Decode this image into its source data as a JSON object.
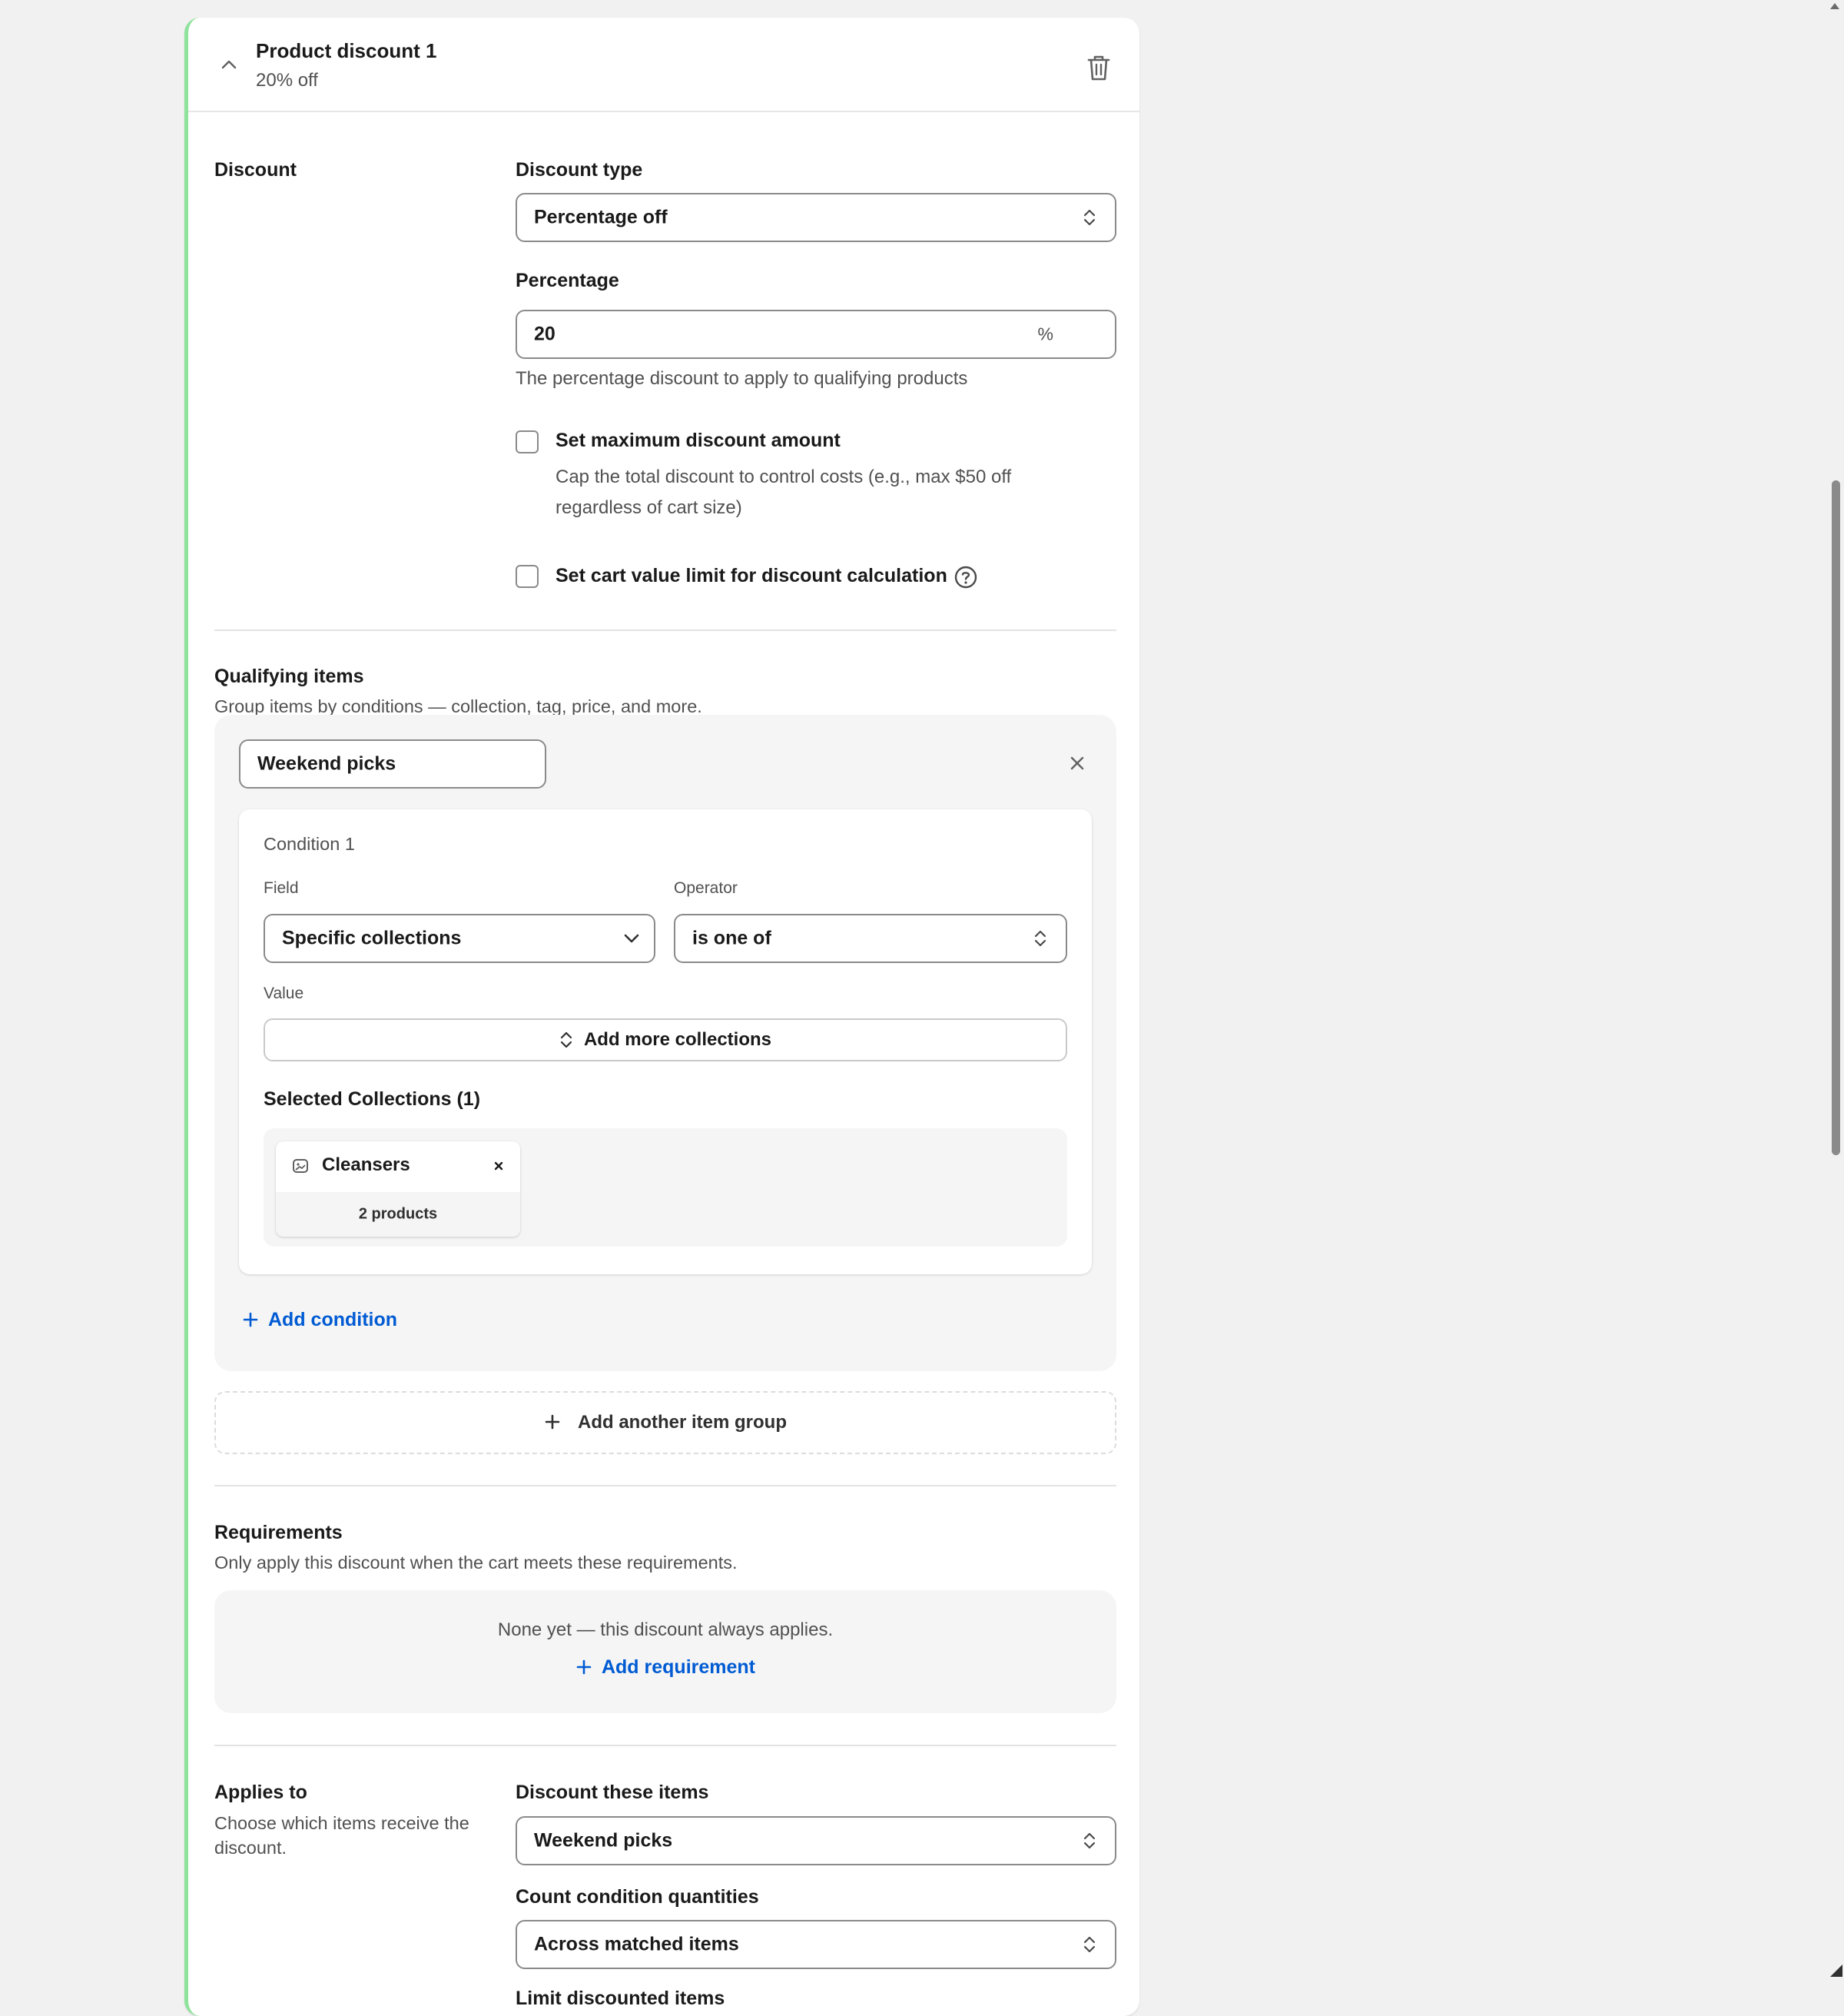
{
  "header": {
    "title": "Product discount 1",
    "subtitle": "20% off"
  },
  "discount": {
    "section_label": "Discount",
    "type_label": "Discount type",
    "type_value": "Percentage off",
    "percentage_label": "Percentage",
    "percentage_value": "20",
    "percentage_suffix": "%",
    "percentage_hint": "The percentage discount to apply to qualifying products",
    "max_amount_label": "Set maximum discount amount",
    "max_amount_hint_line1": "Cap the total discount to control costs (e.g., max $50 off",
    "max_amount_hint_line2": "regardless of cart size)",
    "cart_limit_label": "Set cart value limit for discount calculation"
  },
  "qualifying": {
    "title": "Qualifying items",
    "description": "Group items by conditions — collection, tag, price, and more.",
    "group_name": "Weekend picks",
    "condition": {
      "title": "Condition 1",
      "field_label": "Field",
      "field_value": "Specific collections",
      "operator_label": "Operator",
      "operator_value": "is one of",
      "value_label": "Value",
      "add_more_label": "Add more collections",
      "selected_title": "Selected Collections (1)",
      "collections": [
        {
          "name": "Cleansers",
          "count": "2 products"
        }
      ]
    },
    "add_condition_label": "Add condition",
    "add_group_label": "Add another item group"
  },
  "requirements": {
    "title": "Requirements",
    "description": "Only apply this discount when the cart meets these requirements.",
    "empty_text": "None yet — this discount always applies.",
    "add_label": "Add requirement"
  },
  "applies_to": {
    "title": "Applies to",
    "description_line1": "Choose which items receive the",
    "description_line2": "discount.",
    "items_label": "Discount these items",
    "items_value": "Weekend picks",
    "count_label": "Count condition quantities",
    "count_value": "Across matched items",
    "next_label_partial": "Limit discounted items"
  },
  "colors": {
    "accent_link": "#005bd3",
    "card_left_border": "#8ee39b"
  }
}
